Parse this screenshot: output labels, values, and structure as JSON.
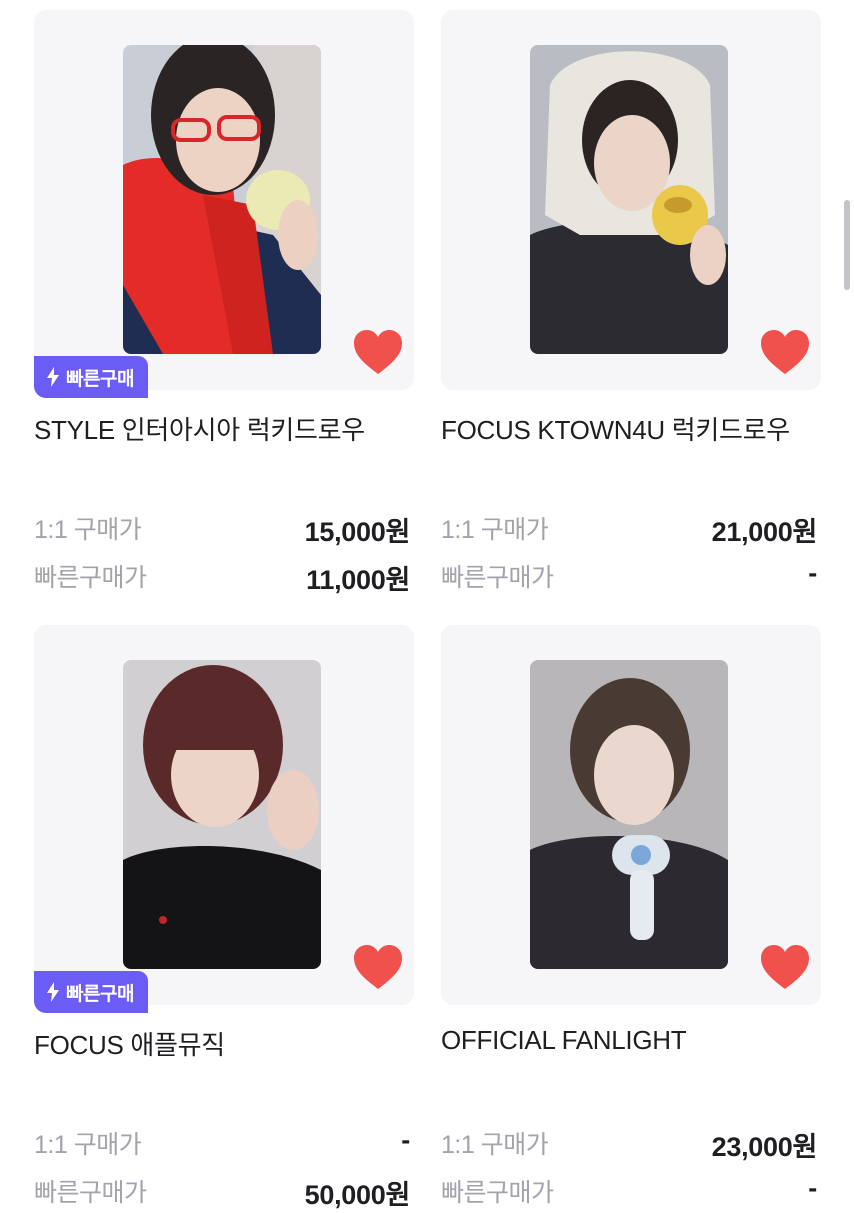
{
  "colors": {
    "accent": "#6b5cf6",
    "heart": "#f0514c",
    "muted": "#a3a3ab"
  },
  "products": [
    {
      "title": "STYLE 인터아시아 럭키드로우",
      "liked": true,
      "fast_badge": "빠른구매",
      "price_1to1_label": "1:1 구매가",
      "price_1to1": "15,000원",
      "price_fast_label": "빠른구매가",
      "price_fast": "11,000원"
    },
    {
      "title": "FOCUS KTOWN4U 럭키드로우",
      "liked": true,
      "fast_badge": null,
      "price_1to1_label": "1:1 구매가",
      "price_1to1": "21,000원",
      "price_fast_label": "빠른구매가",
      "price_fast": "-"
    },
    {
      "title": "FOCUS 애플뮤직",
      "liked": true,
      "fast_badge": "빠른구매",
      "price_1to1_label": "1:1 구매가",
      "price_1to1": "-",
      "price_fast_label": "빠른구매가",
      "price_fast": "50,000원"
    },
    {
      "title": "OFFICIAL FANLIGHT",
      "liked": true,
      "fast_badge": null,
      "price_1to1_label": "1:1 구매가",
      "price_1to1": "23,000원",
      "price_fast_label": "빠른구매가",
      "price_fast": "-"
    }
  ]
}
